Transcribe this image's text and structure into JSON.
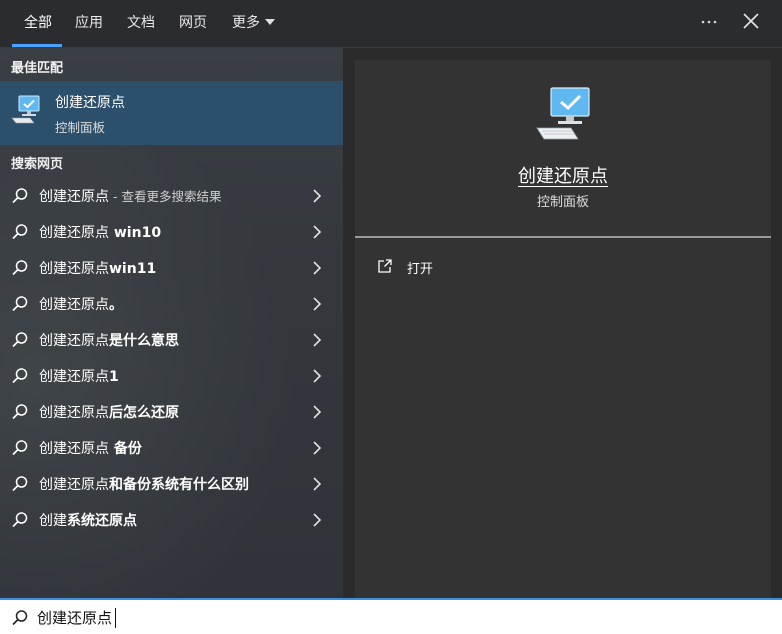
{
  "tabs": [
    {
      "label": "全部",
      "active": true
    },
    {
      "label": "应用",
      "active": false
    },
    {
      "label": "文档",
      "active": false
    },
    {
      "label": "网页",
      "active": false
    },
    {
      "label": "更多",
      "active": false
    }
  ],
  "toolbar": {
    "more_icon": "more-options-icon",
    "close_icon": "close-icon"
  },
  "best_match": {
    "heading": "最佳匹配",
    "title": "创建还原点",
    "subtitle": "控制面板",
    "icon": "computer-check-icon"
  },
  "web_section": {
    "heading": "搜索网页",
    "items": [
      {
        "prefix": "创建还原点",
        "bold": "",
        "hint": " - 查看更多搜索结果"
      },
      {
        "prefix": "创建还原点",
        "bold": " win10",
        "hint": ""
      },
      {
        "prefix": "创建还原点",
        "bold": "win11",
        "hint": ""
      },
      {
        "prefix": "创建还原点",
        "bold": "。",
        "hint": ""
      },
      {
        "prefix": "创建还原点",
        "bold": "是什么意思",
        "hint": ""
      },
      {
        "prefix": "创建还原点",
        "bold": "1",
        "hint": ""
      },
      {
        "prefix": "创建还原点",
        "bold": "后怎么还原",
        "hint": ""
      },
      {
        "prefix": "创建还原点",
        "bold": " 备份",
        "hint": ""
      },
      {
        "prefix": "创建还原点",
        "bold": "和备份系统有什么区别",
        "hint": ""
      },
      {
        "prefix": "创建",
        "bold": "系统还原点",
        "hint": ""
      }
    ]
  },
  "detail": {
    "title": "创建还原点",
    "subtitle": "控制面板",
    "open_label": "打开",
    "icon": "computer-check-icon"
  },
  "search": {
    "value": "创建还原点",
    "icon": "search-icon"
  },
  "colors": {
    "accent": "#4aa3ff",
    "selected_bg": "#2c4f6b",
    "panel_bg": "#333333"
  }
}
